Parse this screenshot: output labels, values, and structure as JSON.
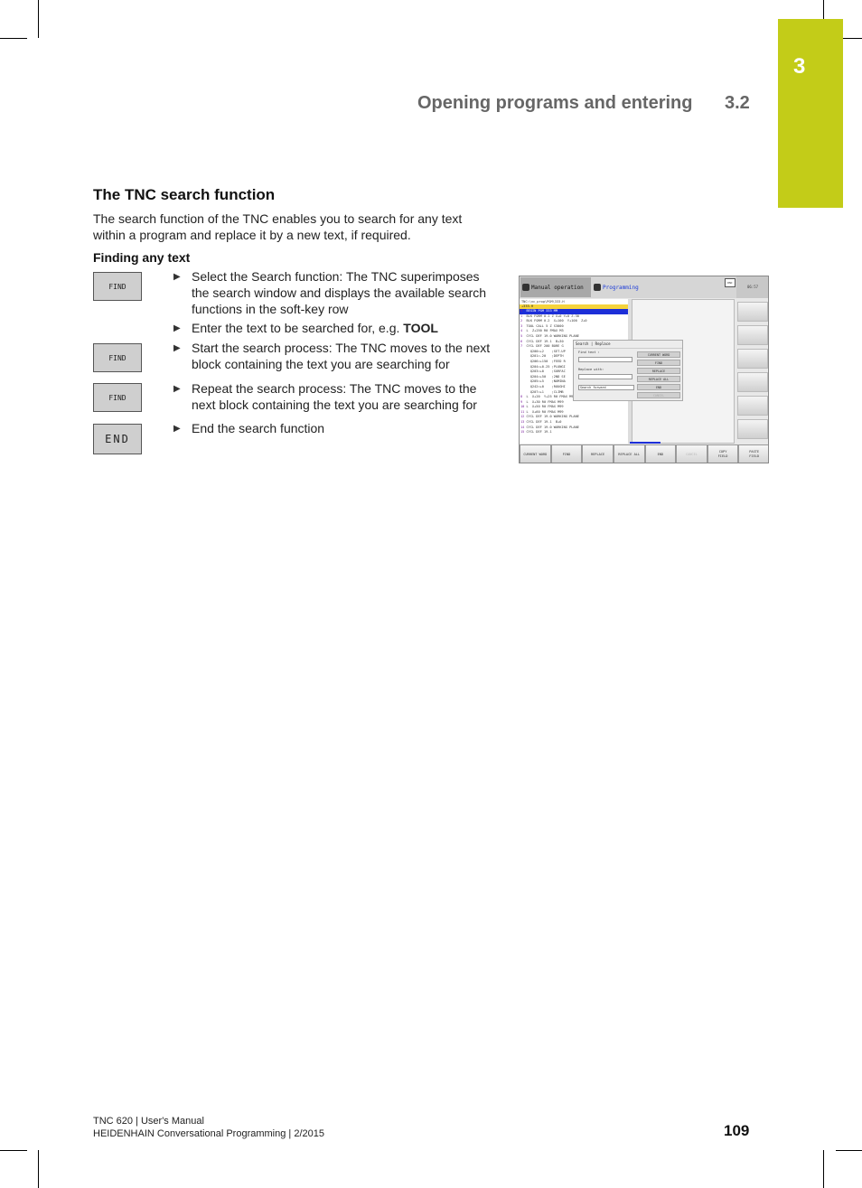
{
  "chapter_tab": {
    "number": "3",
    "color": "#c3cc18"
  },
  "running_header": {
    "title": "Opening programs and entering",
    "section": "3.2"
  },
  "section": {
    "title": "The TNC search function",
    "intro": "The search function of the TNC enables you to search for any text within a program and replace it by a new text, if required.",
    "subheading": "Finding any text"
  },
  "steps": [
    {
      "key": "FIND",
      "text": "Select the Search function: The TNC superimposes the search window and displays the available search functions in the soft-key row"
    },
    {
      "key": "",
      "text": "Enter the text to be searched for, e.g. ",
      "bold": "TOOL"
    },
    {
      "key": "FIND",
      "text": "Start the search process: The TNC moves to the next block containing the text you are searching for"
    },
    {
      "key": "FIND",
      "text": "Repeat the search process: The TNC moves to the next block containing the text you are searching for"
    },
    {
      "key": "END",
      "text": "End the search function"
    }
  ],
  "screenshot": {
    "mode_manual": "Manual operation",
    "mode_programming": "Programming",
    "dnc": "DNC",
    "clock": "06:57",
    "path": "TNC:\\nc_prog\\PGM\\333.H",
    "file": "→333.H",
    "lines": [
      {
        "n": "0",
        "t": "  BEGIN PGM 333 MM",
        "sel": true
      },
      {
        "n": "1",
        "t": "  BLK FORM 0.1 Z X+0 Y+0 Z-30"
      },
      {
        "n": "2",
        "t": "  BLK FORM 0.2  X+100  Y+100  Z+0"
      },
      {
        "n": "3",
        "t": "  TOOL CALL 5 Z S3000"
      },
      {
        "n": "4",
        "t": "  L  Z+250 R0 FMAX M3"
      },
      {
        "n": "5",
        "t": "  CYCL DEF 19.0 WORKING PLANE"
      },
      {
        "n": "6",
        "t": "  CYCL DEF 19.1  B+30"
      },
      {
        "n": "7",
        "t": "  CYCL DEF 200 BORE G"
      },
      {
        "n": "",
        "t": "     Q200=+2    ;SET-UP"
      },
      {
        "n": "",
        "t": "     Q201=-20   ;DEPTH"
      },
      {
        "n": "",
        "t": "     Q206=+150  ;FEED R"
      },
      {
        "n": "",
        "t": "     Q204=+0.25 ;PLUNGI"
      },
      {
        "n": "",
        "t": "     Q203=+0    ;SURFAC"
      },
      {
        "n": "",
        "t": "     Q204=+50   ;2ND SE"
      },
      {
        "n": "",
        "t": "     Q205=+5    ;NOMINA"
      },
      {
        "n": "",
        "t": "     Q242=+0    ;ROUGHI"
      },
      {
        "n": "",
        "t": "     Q207=+1    ;CLIMB"
      },
      {
        "n": "8",
        "t": "  L  X+20  Y+25 R0 FMAX M99"
      },
      {
        "n": "9",
        "t": "  L  X+30 R0 FMAX M99"
      },
      {
        "n": "10",
        "t": " L  X+50 R0 FMAX M99"
      },
      {
        "n": "11",
        "t": " L  X+60 R0 FMAX M99"
      },
      {
        "n": "12",
        "t": " CYCL DEF 19.0 WORKING PLANE"
      },
      {
        "n": "13",
        "t": " CYCL DEF 19.1  B+0"
      },
      {
        "n": "14",
        "t": " CYCL DEF 19.0 WORKING PLANE"
      },
      {
        "n": "15",
        "t": " CYCL DEF 19.1"
      }
    ],
    "dialog": {
      "title": "Search | Replace",
      "find_label": "Find text :",
      "find_value": "",
      "replace_label": "Replace with:",
      "replace_value": "",
      "direction": "Search forward",
      "buttons": [
        "CURRENT WORD",
        "FIND",
        "REPLACE",
        "REPLACE ALL",
        "END",
        "CANCEL"
      ]
    },
    "softkeys": [
      "CURRENT WORD",
      "FIND",
      "REPLACE",
      "REPLACE ALL",
      "END",
      "CANCEL",
      "COPY\nFIELD",
      "PASTE\nFIELD"
    ]
  },
  "footer": {
    "line1": "TNC 620 | User's Manual",
    "line2": "HEIDENHAIN Conversational Programming | 2/2015",
    "page": "109"
  }
}
